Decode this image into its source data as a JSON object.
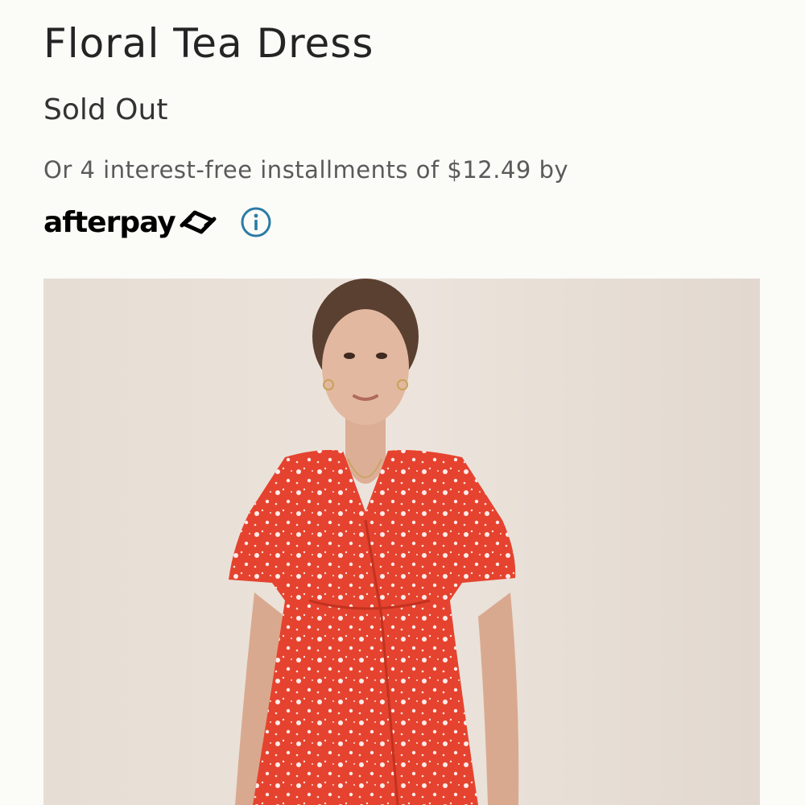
{
  "product": {
    "title": "Floral Tea Dress",
    "status": "Sold Out",
    "installments_text": "Or 4 interest-free installments of $12.49 by",
    "payment_brand": "afterpay"
  },
  "icons": {
    "afterpay_logo": "afterpay-arrows-icon",
    "info": "info-icon"
  },
  "colors": {
    "background": "#fbfbf8",
    "info_accent": "#2a7ba6",
    "dress": "#e5432f",
    "image_backdrop": "#e8dfd7"
  }
}
